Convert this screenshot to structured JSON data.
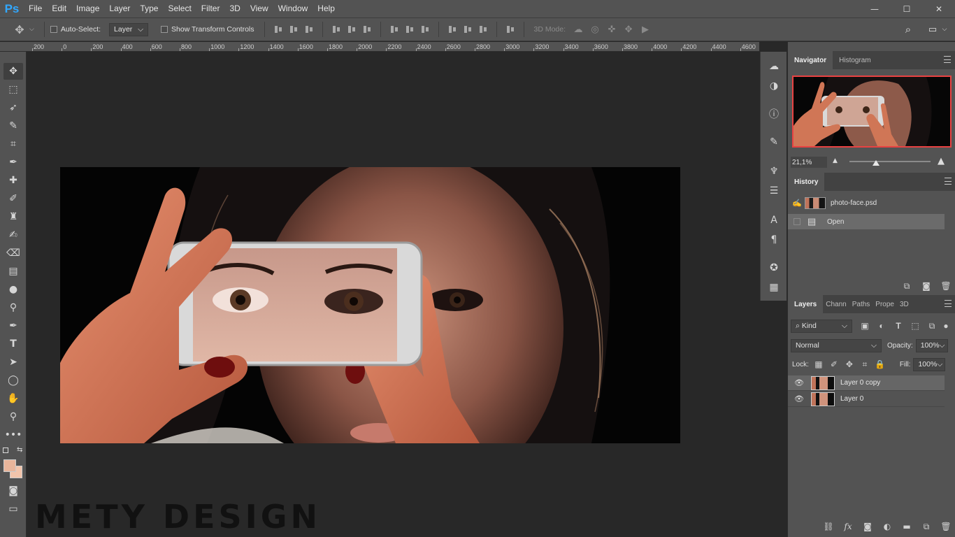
{
  "app": {
    "logo": "Ps"
  },
  "menu": [
    "File",
    "Edit",
    "Image",
    "Layer",
    "Type",
    "Select",
    "Filter",
    "3D",
    "View",
    "Window",
    "Help"
  ],
  "window_controls": {
    "minimize": "—",
    "maximize": "☐",
    "close": "✕"
  },
  "options": {
    "auto_select_label": "Auto-Select:",
    "auto_select_value": "Layer",
    "show_transform_label": "Show Transform Controls",
    "mode_3d_label": "3D Mode:"
  },
  "ruler": {
    "labels": [
      "200",
      "0",
      "200",
      "400",
      "600",
      "800",
      "1000",
      "1200",
      "1400",
      "1600",
      "1800",
      "2000",
      "2200",
      "2400",
      "2600",
      "2800",
      "3000",
      "3200",
      "3400",
      "3600",
      "3800",
      "4000",
      "4200",
      "4400",
      "4600"
    ]
  },
  "watermark": "METY DESIGN",
  "navigator": {
    "tabs": [
      "Navigator",
      "Histogram"
    ],
    "zoom": "21,1%",
    "zoom_fraction": 0.33
  },
  "history": {
    "title": "History",
    "snapshot": "photo-face.psd",
    "items": [
      "Open"
    ]
  },
  "layers_panel": {
    "tabs": [
      "Layers",
      "Chann",
      "Paths",
      "Prope",
      "3D"
    ],
    "filter_kind": "Kind",
    "blend_mode": "Normal",
    "opacity_label": "Opacity:",
    "opacity_value": "100%",
    "lock_label": "Lock:",
    "fill_label": "Fill:",
    "fill_value": "100%",
    "layers": [
      "Layer 0 copy",
      "Layer 0"
    ]
  },
  "colors": {
    "foreground": "#e8b59b",
    "background": "#f2c4ab",
    "accent_ps": "#31a8ff",
    "navigator_frame": "#e84242"
  },
  "footer_icons": {
    "fx": "fx"
  }
}
